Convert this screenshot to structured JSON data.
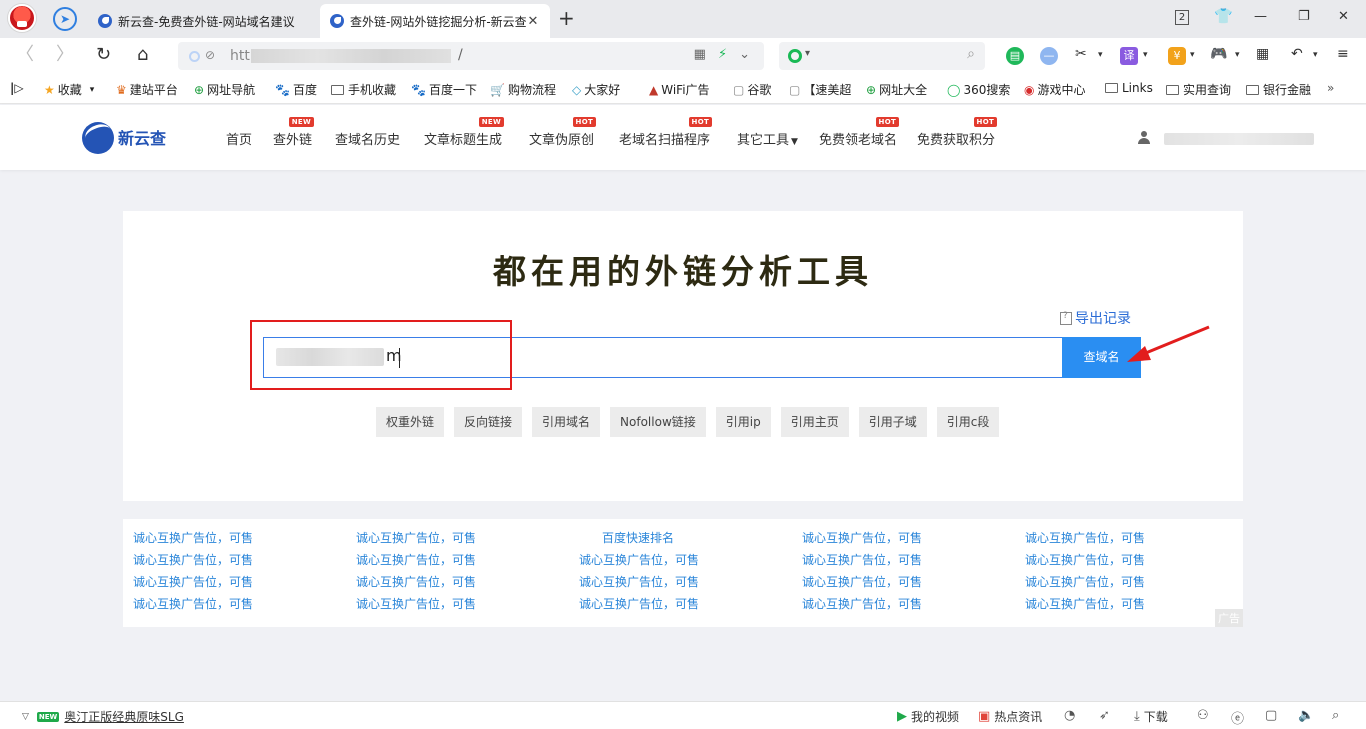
{
  "browser": {
    "tabs": [
      {
        "title": "新云查-免费查外链-网站域名建议"
      },
      {
        "title": "查外链-网站外链挖掘分析-新云查"
      }
    ],
    "new_tab_symbol": "+",
    "tab_count": "2",
    "url_prefix": "htt",
    "url_suffix": "/",
    "nav_icons": {
      "back": "back-arrow-icon",
      "forward": "forward-arrow-icon",
      "reload": "reload-icon",
      "home": "home-icon"
    }
  },
  "bookmarks": [
    {
      "label": "收藏"
    },
    {
      "label": "建站平台"
    },
    {
      "label": "网址导航"
    },
    {
      "label": "百度"
    },
    {
      "label": "手机收藏"
    },
    {
      "label": "百度一下"
    },
    {
      "label": "购物流程"
    },
    {
      "label": "大家好"
    },
    {
      "label": "WiFi广告"
    },
    {
      "label": "谷歌"
    },
    {
      "label": "【速美超"
    },
    {
      "label": "网址大全"
    },
    {
      "label": "360搜索"
    },
    {
      "label": "游戏中心"
    },
    {
      "label": "Links"
    },
    {
      "label": "实用查询"
    },
    {
      "label": "银行金融"
    }
  ],
  "site": {
    "logo_text": "新云查",
    "nav": [
      {
        "label": "首页",
        "badge": ""
      },
      {
        "label": "查外链",
        "badge": "NEW"
      },
      {
        "label": "查域名历史",
        "badge": ""
      },
      {
        "label": "文章标题生成",
        "badge": "NEW"
      },
      {
        "label": "文章伪原创",
        "badge": "HOT"
      },
      {
        "label": "老域名扫描程序",
        "badge": "HOT"
      },
      {
        "label": "其它工具",
        "badge": ""
      },
      {
        "label": "免费领老域名",
        "badge": "HOT"
      },
      {
        "label": "免费获取积分",
        "badge": "HOT"
      }
    ]
  },
  "tool": {
    "title": "都在用的外链分析工具",
    "export_label": "导出记录",
    "input_visible_tail": "m",
    "query_button": "查域名",
    "filters": [
      "权重外链",
      "反向链接",
      "引用域名",
      "Nofollow链接",
      "引用ip",
      "引用主页",
      "引用子域",
      "引用c段"
    ]
  },
  "ads": {
    "rows": [
      [
        "诚心互换广告位，可售",
        "诚心互换广告位，可售",
        "百度快速排名",
        "诚心互换广告位，可售",
        "诚心互换广告位，可售"
      ],
      [
        "诚心互换广告位，可售",
        "诚心互换广告位，可售",
        "诚心互换广告位，可售",
        "诚心互换广告位，可售",
        "诚心互换广告位，可售"
      ],
      [
        "诚心互换广告位，可售",
        "诚心互换广告位，可售",
        "诚心互换广告位，可售",
        "诚心互换广告位，可售",
        "诚心互换广告位，可售"
      ],
      [
        "诚心互换广告位，可售",
        "诚心互换广告位，可售",
        "诚心互换广告位，可售",
        "诚心互换广告位，可售",
        "诚心互换广告位，可售"
      ]
    ],
    "tag": "广告"
  },
  "statusbar": {
    "new_badge": "NEW",
    "promo": "奥汀正版经典原味SLG",
    "my_video": "我的视频",
    "hot_news": "热点资讯",
    "download": "下载"
  },
  "colors": {
    "accent": "#2a8ef2",
    "brand": "#2454b5",
    "link": "#2b86d9",
    "badge": "#e23b2e",
    "annotation": "#e21d1d"
  }
}
